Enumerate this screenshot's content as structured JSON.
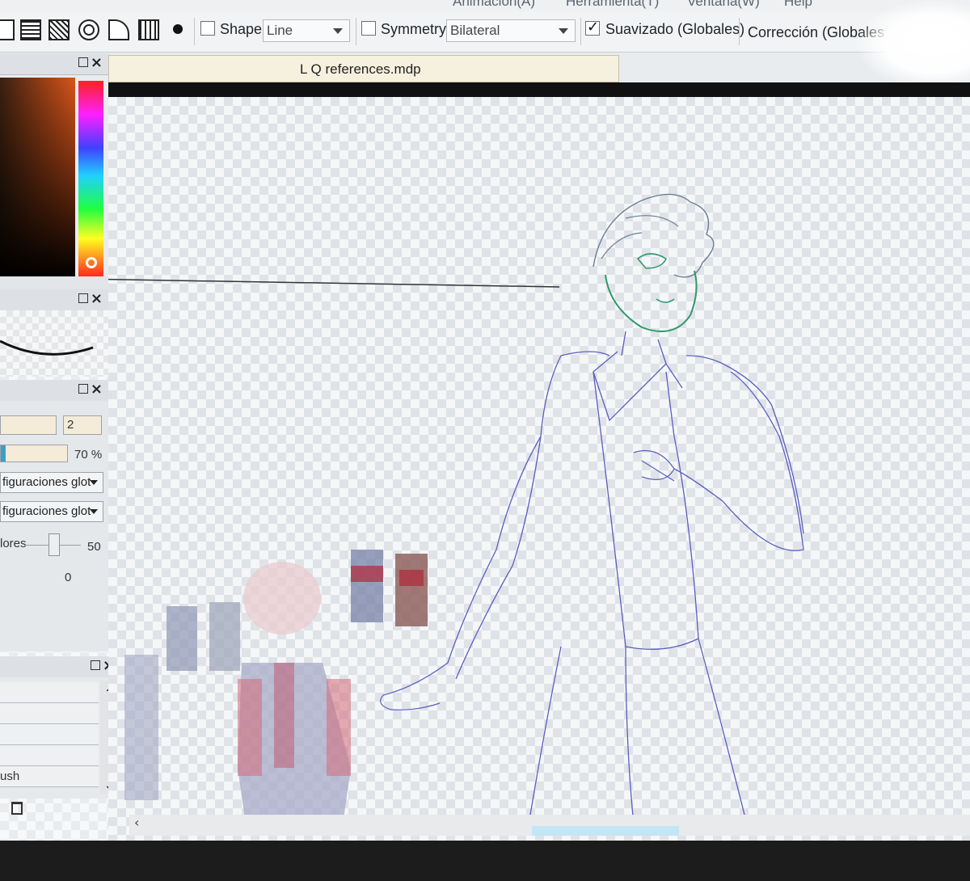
{
  "menu": {
    "items": [
      "Animación(A)",
      "Herramienta(T)",
      "Ventana(W)",
      "Help"
    ]
  },
  "toolbar": {
    "shape_label": "Shape",
    "shape_value": "Line",
    "symmetry_label": "Symmetry",
    "symmetry_value": "Bilateral",
    "smoothing_label": "Suavizado (Globales)",
    "correction_label": "Corrección (Globales"
  },
  "document": {
    "tab_title": "L  Q references.mdp"
  },
  "brush_settings": {
    "size_value": "2",
    "opacity_percent": 70,
    "opacity_label": "70 %",
    "dropdown1": "figuraciones glot",
    "dropdown2": "figuraciones glot",
    "slider_label": "lores",
    "slider_value": "50",
    "zero_value": "0"
  },
  "layers": {
    "rows": [
      "",
      "",
      "",
      "",
      "ush"
    ]
  },
  "colors": {
    "accent": "#3aa0c8",
    "field_bg": "#f4ebd9",
    "sketch_line": "#5a5fc0",
    "sketch_green": "#2e9a6a"
  }
}
